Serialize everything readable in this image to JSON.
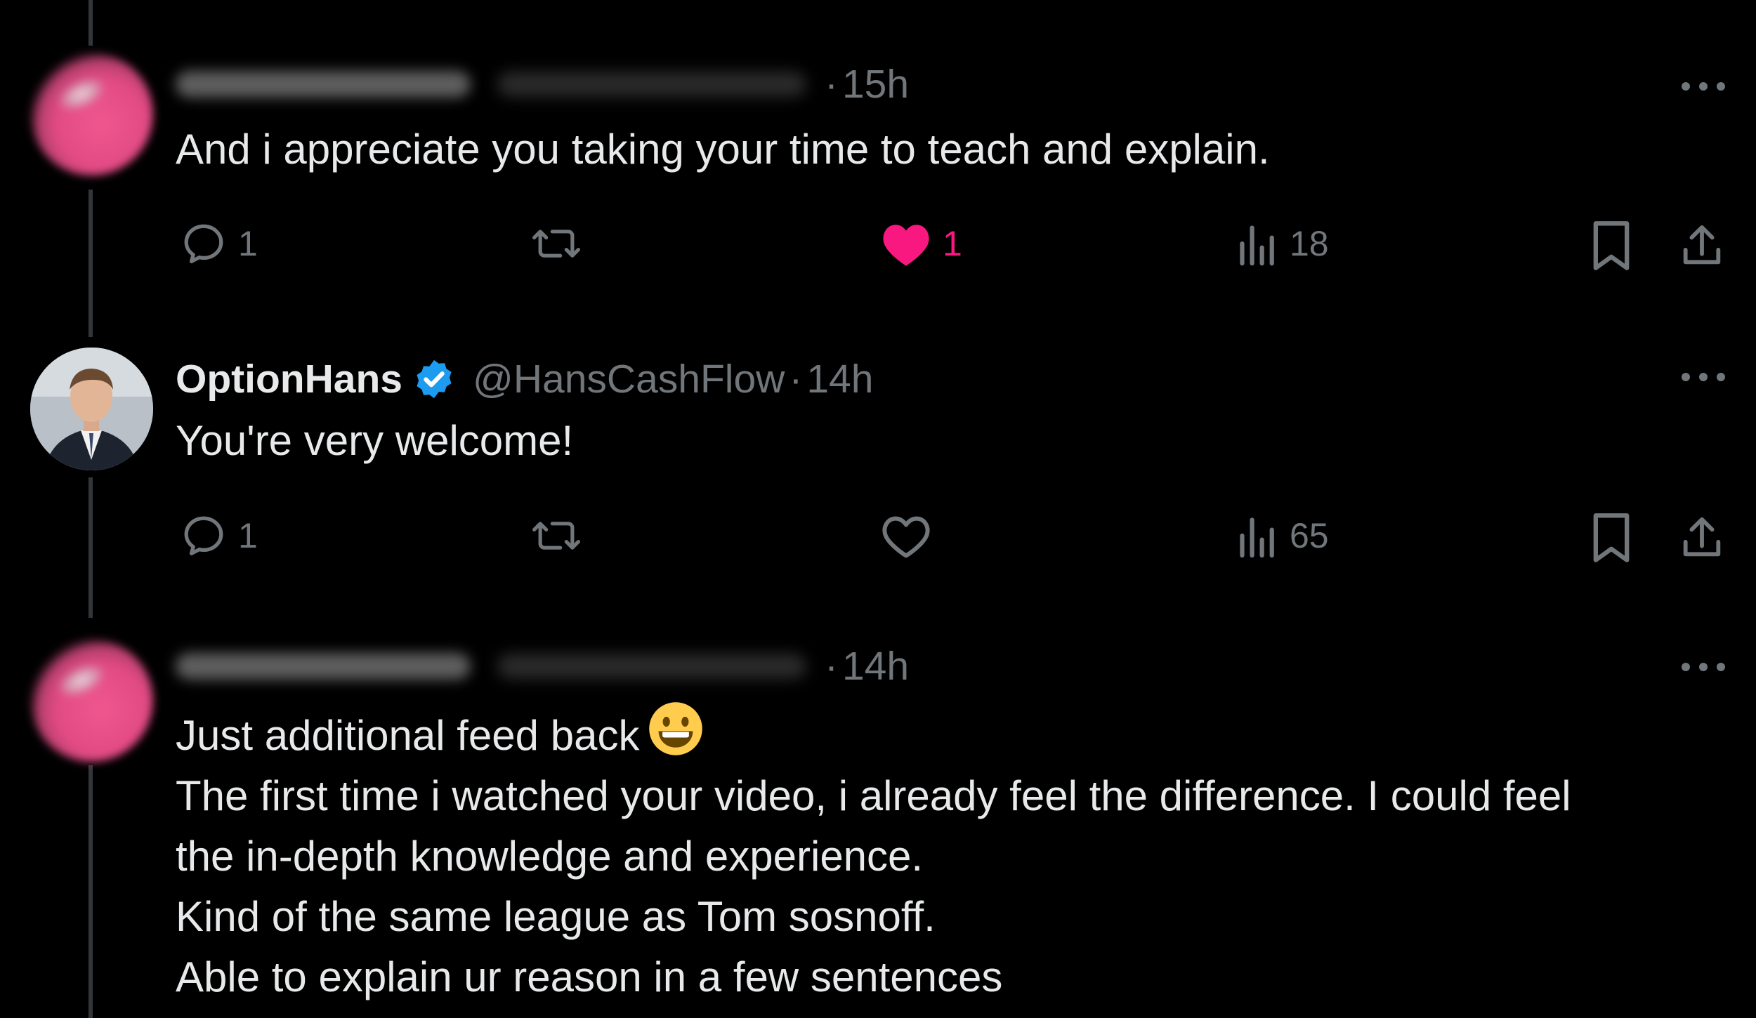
{
  "tweets": [
    {
      "author_blurred": true,
      "time": "15h",
      "text_lines": [
        "And i appreciate you taking your time to teach and explain."
      ],
      "reply_count": "1",
      "like_count": "1",
      "liked": true,
      "view_count": "18"
    },
    {
      "author_name": "OptionHans",
      "verified": true,
      "handle": "@HansCashFlow",
      "time": "14h",
      "text_lines": [
        "You're very welcome!"
      ],
      "reply_count": "1",
      "like_count": "",
      "liked": false,
      "view_count": "65"
    },
    {
      "author_blurred": true,
      "time": "14h",
      "text_lines": [
        "Just additional feed back",
        "The first time i watched your video, i already feel the difference. I could feel",
        "the in-depth knowledge and experience.",
        "Kind of the same league as Tom sosnoff.",
        "Able to explain ur reason in a few sentences"
      ],
      "emoji": "grinning-face"
    }
  ],
  "separator": "·",
  "colors": {
    "accent": "#1d9bf0",
    "like": "#f91880",
    "muted": "#71767b",
    "text": "#e7e9ea"
  },
  "icons": [
    "reply-icon",
    "retweet-icon",
    "like-icon",
    "views-icon",
    "bookmark-icon",
    "share-icon",
    "more-icon",
    "verified-icon"
  ]
}
